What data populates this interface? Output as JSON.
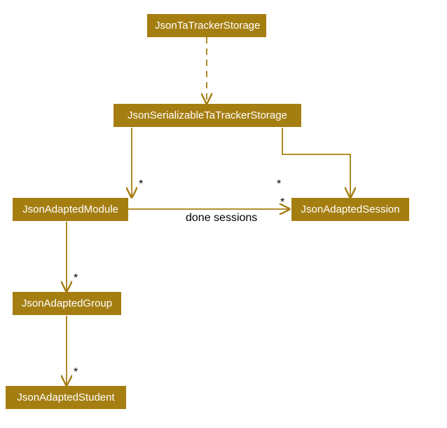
{
  "nodes": {
    "n0": {
      "label": "JsonTaTrackerStorage"
    },
    "n1": {
      "label": "JsonSerializableTaTrackerStorage"
    },
    "n2": {
      "label": "JsonAdaptedModule"
    },
    "n3": {
      "label": "JsonAdaptedSession"
    },
    "n4": {
      "label": "JsonAdaptedGroup"
    },
    "n5": {
      "label": "JsonAdaptedStudent"
    }
  },
  "edges": {
    "e_n1_n2_mult": "*",
    "e_n1_n3_mult": "*",
    "e_n2_n3_mult": "*",
    "e_n2_n3_label": "done sessions",
    "e_n2_n4_mult": "*",
    "e_n4_n5_mult": "*"
  },
  "chart_data": {
    "type": "diagram",
    "diagram_type": "uml-class-diagram",
    "nodes": [
      {
        "id": "JsonTaTrackerStorage"
      },
      {
        "id": "JsonSerializableTaTrackerStorage"
      },
      {
        "id": "JsonAdaptedModule"
      },
      {
        "id": "JsonAdaptedSession"
      },
      {
        "id": "JsonAdaptedGroup"
      },
      {
        "id": "JsonAdaptedStudent"
      }
    ],
    "edges": [
      {
        "from": "JsonTaTrackerStorage",
        "to": "JsonSerializableTaTrackerStorage",
        "style": "dashed",
        "multiplicity": null,
        "label": null
      },
      {
        "from": "JsonSerializableTaTrackerStorage",
        "to": "JsonAdaptedModule",
        "style": "solid",
        "multiplicity": "*",
        "label": null
      },
      {
        "from": "JsonSerializableTaTrackerStorage",
        "to": "JsonAdaptedSession",
        "style": "solid",
        "multiplicity": "*",
        "label": null
      },
      {
        "from": "JsonAdaptedModule",
        "to": "JsonAdaptedSession",
        "style": "solid",
        "multiplicity": "*",
        "label": "done sessions"
      },
      {
        "from": "JsonAdaptedModule",
        "to": "JsonAdaptedGroup",
        "style": "solid",
        "multiplicity": "*",
        "label": null
      },
      {
        "from": "JsonAdaptedGroup",
        "to": "JsonAdaptedStudent",
        "style": "solid",
        "multiplicity": "*",
        "label": null
      }
    ]
  }
}
